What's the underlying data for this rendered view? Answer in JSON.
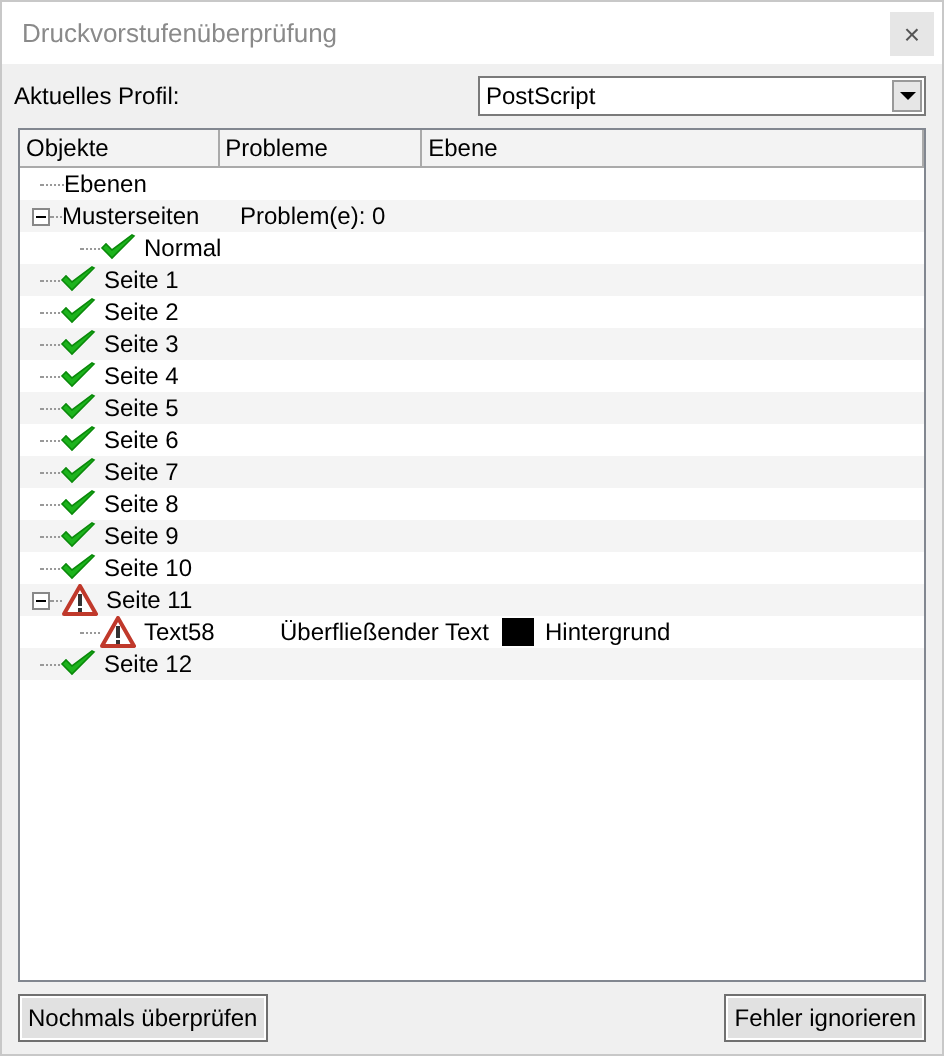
{
  "window": {
    "title": "Druckvorstufenüberprüfung",
    "close": "×"
  },
  "profile": {
    "label": "Aktuelles Profil:",
    "value": "PostScript"
  },
  "table": {
    "columns": [
      "Objekte",
      "Probleme",
      "Ebene"
    ],
    "rows": [
      {
        "name": "Ebenen",
        "kind": "plain"
      },
      {
        "name": "Musterseiten",
        "kind": "plain",
        "problem": "Problem(e): 0",
        "expanded": true,
        "children": [
          {
            "name": "Normal",
            "kind": "ok"
          }
        ]
      },
      {
        "name": "Seite 1",
        "kind": "ok"
      },
      {
        "name": "Seite 2",
        "kind": "ok"
      },
      {
        "name": "Seite 3",
        "kind": "ok"
      },
      {
        "name": "Seite 4",
        "kind": "ok"
      },
      {
        "name": "Seite 5",
        "kind": "ok"
      },
      {
        "name": "Seite 6",
        "kind": "ok"
      },
      {
        "name": "Seite 7",
        "kind": "ok"
      },
      {
        "name": "Seite 8",
        "kind": "ok"
      },
      {
        "name": "Seite 9",
        "kind": "ok"
      },
      {
        "name": "Seite 10",
        "kind": "ok"
      },
      {
        "name": "Seite 11",
        "kind": "warning",
        "expanded": true,
        "children": [
          {
            "name": "Text58",
            "kind": "warning",
            "problem": "Überfließender Text",
            "color": "#000000",
            "layer": "Hintergrund"
          }
        ]
      },
      {
        "name": "Seite 12",
        "kind": "ok"
      }
    ]
  },
  "buttons": [
    "Nochmals überprüfen",
    "Fehler ignorieren"
  ]
}
